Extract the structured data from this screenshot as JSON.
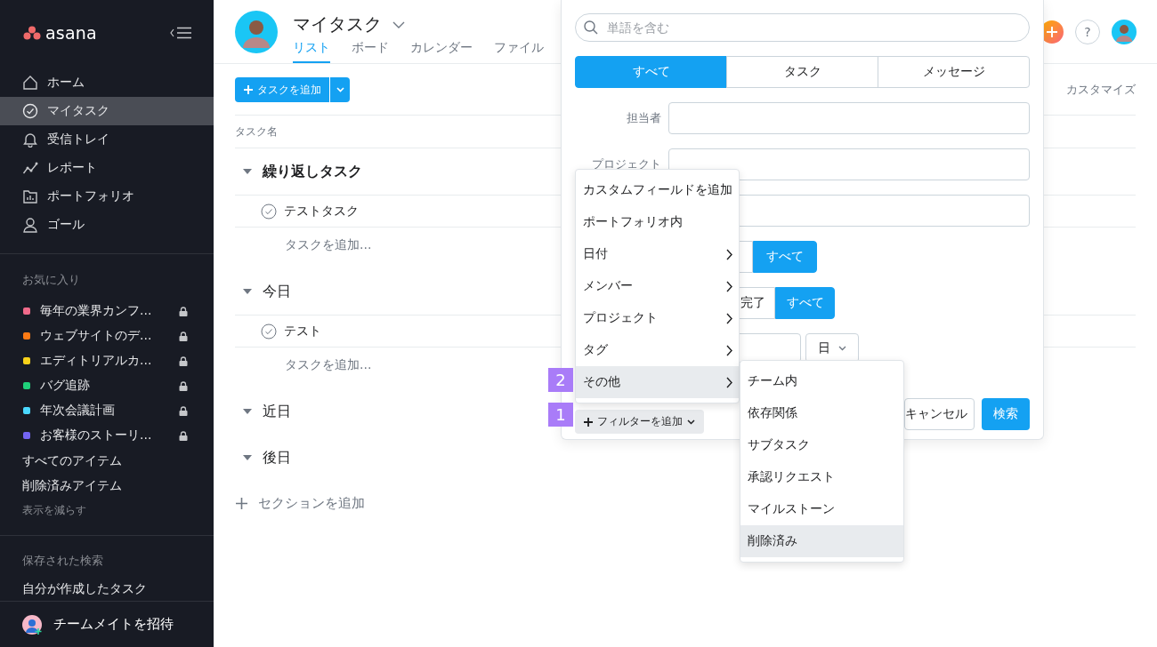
{
  "sidebar": {
    "logo": "asana",
    "nav": [
      {
        "label": "ホーム",
        "kind": "home",
        "selected": false
      },
      {
        "label": "マイタスク",
        "kind": "check",
        "selected": true
      },
      {
        "label": "受信トレイ",
        "kind": "bell",
        "selected": false
      },
      {
        "label": "レポート",
        "kind": "chart",
        "selected": false
      },
      {
        "label": "ポートフォリオ",
        "kind": "portfolio",
        "selected": false
      },
      {
        "label": "ゴール",
        "kind": "goal",
        "selected": false
      }
    ],
    "favorites_title": "お気に入り",
    "favorites": [
      {
        "label": "毎年の業界カンフ...",
        "color": "#f06a8a",
        "locked": true
      },
      {
        "label": "ウェブサイトのデ...",
        "color": "#fd7a14",
        "locked": true
      },
      {
        "label": "エディトリアルカ...",
        "color": "#f8d21a",
        "locked": true
      },
      {
        "label": "バグ追跡",
        "color": "#1fd07a",
        "locked": true
      },
      {
        "label": "年次会議計画",
        "color": "#4ad8ff",
        "locked": true
      },
      {
        "label": "お客様のストーリ...",
        "color": "#7364f2",
        "locked": true
      }
    ],
    "links": [
      "すべてのアイテム",
      "削除済みアイテム"
    ],
    "show_less": "表示を減らす",
    "saved_title": "保存された検索",
    "saved": [
      "自分が作成したタスク"
    ],
    "invite": "チームメイトを招待"
  },
  "header": {
    "title": "マイタスク",
    "tabs": [
      {
        "label": "リスト",
        "selected": true
      },
      {
        "label": "ボード",
        "selected": false
      },
      {
        "label": "カレンダー",
        "selected": false
      },
      {
        "label": "ファイル",
        "selected": false
      }
    ],
    "help": "?"
  },
  "toolbar": {
    "add_button": "タスクを追加",
    "customize": "カスタマイズ"
  },
  "list": {
    "column": "タスク名",
    "sections": [
      {
        "title": "繰り返しタスク",
        "emphasized": true,
        "expanded": true,
        "tasks": [
          {
            "name": "テストタスク",
            "completed": false
          }
        ],
        "add_task": "タスクを追加..."
      },
      {
        "title": "今日",
        "emphasized": false,
        "expanded": true,
        "tasks": [
          {
            "name": "テスト",
            "completed": false
          }
        ],
        "add_task": "タスクを追加..."
      },
      {
        "title": "近日",
        "emphasized": false,
        "expanded": true
      },
      {
        "title": "後日",
        "emphasized": false,
        "expanded": true
      }
    ],
    "add_section": "セクションを追加"
  },
  "search_panel": {
    "placeholder": "単語を含む",
    "scope_tabs": [
      {
        "label": "すべて",
        "selected": true
      },
      {
        "label": "タスク",
        "selected": false
      },
      {
        "label": "メッセージ",
        "selected": false
      }
    ],
    "fields": [
      {
        "label": "担当者"
      },
      {
        "label": "プロジェクト"
      }
    ],
    "status_rows": [
      {
        "options": [
          {
            "label": "すべて",
            "selected": true
          }
        ]
      },
      {
        "options": [
          {
            "label": "完了",
            "selected": false
          },
          {
            "label": "すべて",
            "selected": true
          }
        ]
      }
    ],
    "date_unit": "日",
    "filter_button": "フィルターを追加",
    "cancel": "キャンセル",
    "search": "検索"
  },
  "filter_menu": {
    "items": [
      {
        "label": "カスタムフィールドを追加",
        "submenu": false,
        "selected": false
      },
      {
        "label": "ポートフォリオ内",
        "submenu": false,
        "selected": false
      },
      {
        "label": "日付",
        "submenu": true,
        "selected": false
      },
      {
        "label": "メンバー",
        "submenu": true,
        "selected": false
      },
      {
        "label": "プロジェクト",
        "submenu": true,
        "selected": false
      },
      {
        "label": "タグ",
        "submenu": true,
        "selected": false
      },
      {
        "label": "その他",
        "submenu": true,
        "selected": true
      }
    ],
    "submenu": [
      {
        "label": "チーム内",
        "selected": false
      },
      {
        "label": "依存関係",
        "selected": false
      },
      {
        "label": "サブタスク",
        "selected": false
      },
      {
        "label": "承認リクエスト",
        "selected": false
      },
      {
        "label": "マイルストーン",
        "selected": false
      },
      {
        "label": "削除済み",
        "selected": true
      }
    ]
  },
  "markers": [
    "2",
    "1"
  ]
}
